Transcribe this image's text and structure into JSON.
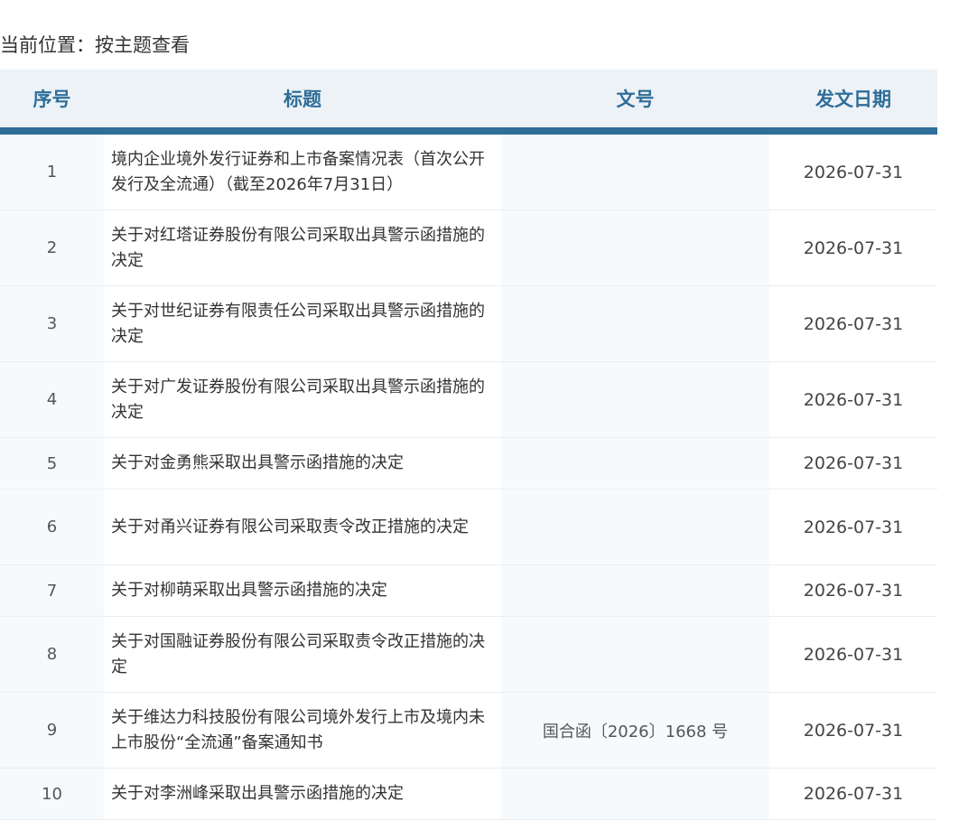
{
  "breadcrumb": {
    "label": "当前位置：",
    "value": "按主题查看"
  },
  "table": {
    "headers": {
      "no": "序号",
      "title": "标题",
      "docno": "文号",
      "date": "发文日期"
    },
    "rows": [
      {
        "no": "1",
        "title": "境内企业境外发行证券和上市备案情况表（首次公开发行及全流通）（截至2026年7月31日）",
        "docno": "",
        "date": "2026-07-31"
      },
      {
        "no": "2",
        "title": "关于对红塔证券股份有限公司采取出具警示函措施的决定",
        "docno": "",
        "date": "2026-07-31"
      },
      {
        "no": "3",
        "title": "关于对世纪证券有限责任公司采取出具警示函措施的决定",
        "docno": "",
        "date": "2026-07-31"
      },
      {
        "no": "4",
        "title": "关于对广发证券股份有限公司采取出具警示函措施的决定",
        "docno": "",
        "date": "2026-07-31"
      },
      {
        "no": "5",
        "title": "关于对金勇熊采取出具警示函措施的决定",
        "docno": "",
        "date": "2026-07-31"
      },
      {
        "no": "6",
        "title": "关于对甬兴证券有限公司采取责令改正措施的决定",
        "docno": "",
        "date": "2026-07-31"
      },
      {
        "no": "7",
        "title": "关于对柳萌采取出具警示函措施的决定",
        "docno": "",
        "date": "2026-07-31"
      },
      {
        "no": "8",
        "title": "关于对国融证券股份有限公司采取责令改正措施的决定",
        "docno": "",
        "date": "2026-07-31"
      },
      {
        "no": "9",
        "title": "关于维达力科技股份有限公司境外发行上市及境内未上市股份“全流通”备案通知书",
        "docno": "国合函〔2026〕1668 号",
        "date": "2026-07-31"
      },
      {
        "no": "10",
        "title": "关于对李洲峰采取出具警示函措施的决定",
        "docno": "",
        "date": "2026-07-31"
      }
    ]
  }
}
